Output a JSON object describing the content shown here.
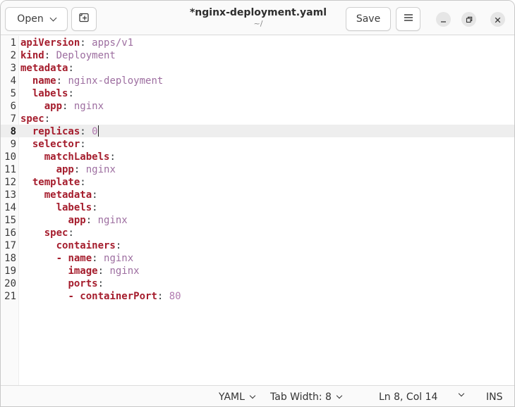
{
  "header": {
    "open_label": "Open",
    "title": "*nginx-deployment.yaml",
    "subtitle": "~/",
    "save_label": "Save"
  },
  "editor": {
    "current_line": 8,
    "lines": [
      {
        "n": "1",
        "indent": "",
        "dash": false,
        "key": "apiVersion",
        "value": "apps/v1",
        "vtype": "val"
      },
      {
        "n": "2",
        "indent": "",
        "dash": false,
        "key": "kind",
        "value": "Deployment",
        "vtype": "val"
      },
      {
        "n": "3",
        "indent": "",
        "dash": false,
        "key": "metadata",
        "value": "",
        "vtype": "val"
      },
      {
        "n": "4",
        "indent": "  ",
        "dash": false,
        "key": "name",
        "value": "nginx-deployment",
        "vtype": "val"
      },
      {
        "n": "5",
        "indent": "  ",
        "dash": false,
        "key": "labels",
        "value": "",
        "vtype": "val"
      },
      {
        "n": "6",
        "indent": "    ",
        "dash": false,
        "key": "app",
        "value": "nginx",
        "vtype": "val"
      },
      {
        "n": "7",
        "indent": "",
        "dash": false,
        "key": "spec",
        "value": "",
        "vtype": "val"
      },
      {
        "n": "8",
        "indent": "  ",
        "dash": false,
        "key": "replicas",
        "value": "0",
        "vtype": "num"
      },
      {
        "n": "9",
        "indent": "  ",
        "dash": false,
        "key": "selector",
        "value": "",
        "vtype": "val"
      },
      {
        "n": "10",
        "indent": "    ",
        "dash": false,
        "key": "matchLabels",
        "value": "",
        "vtype": "val"
      },
      {
        "n": "11",
        "indent": "      ",
        "dash": false,
        "key": "app",
        "value": "nginx",
        "vtype": "val"
      },
      {
        "n": "12",
        "indent": "  ",
        "dash": false,
        "key": "template",
        "value": "",
        "vtype": "val"
      },
      {
        "n": "13",
        "indent": "    ",
        "dash": false,
        "key": "metadata",
        "value": "",
        "vtype": "val"
      },
      {
        "n": "14",
        "indent": "      ",
        "dash": false,
        "key": "labels",
        "value": "",
        "vtype": "val"
      },
      {
        "n": "15",
        "indent": "        ",
        "dash": false,
        "key": "app",
        "value": "nginx",
        "vtype": "val"
      },
      {
        "n": "16",
        "indent": "    ",
        "dash": false,
        "key": "spec",
        "value": "",
        "vtype": "val"
      },
      {
        "n": "17",
        "indent": "      ",
        "dash": false,
        "key": "containers",
        "value": "",
        "vtype": "val"
      },
      {
        "n": "18",
        "indent": "      ",
        "dash": true,
        "key": "name",
        "value": "nginx",
        "vtype": "val"
      },
      {
        "n": "19",
        "indent": "        ",
        "dash": false,
        "key": "image",
        "value": "nginx",
        "vtype": "val"
      },
      {
        "n": "20",
        "indent": "        ",
        "dash": false,
        "key": "ports",
        "value": "",
        "vtype": "val"
      },
      {
        "n": "21",
        "indent": "        ",
        "dash": true,
        "key": "containerPort",
        "value": "80",
        "vtype": "num"
      }
    ]
  },
  "statusbar": {
    "language": "YAML",
    "tab_width": "Tab Width: 8",
    "position": "Ln 8, Col 14",
    "mode": "INS"
  },
  "icons": {
    "new_tab": "new-tab-icon",
    "menu": "hamburger-menu-icon",
    "minimize": "minimize-icon",
    "maximize": "maximize-icon",
    "close": "close-icon"
  },
  "colors": {
    "key": "#a51d2d",
    "value": "#9d6ea0",
    "number": "#b17aaf",
    "current_line": "#eeeeee"
  }
}
